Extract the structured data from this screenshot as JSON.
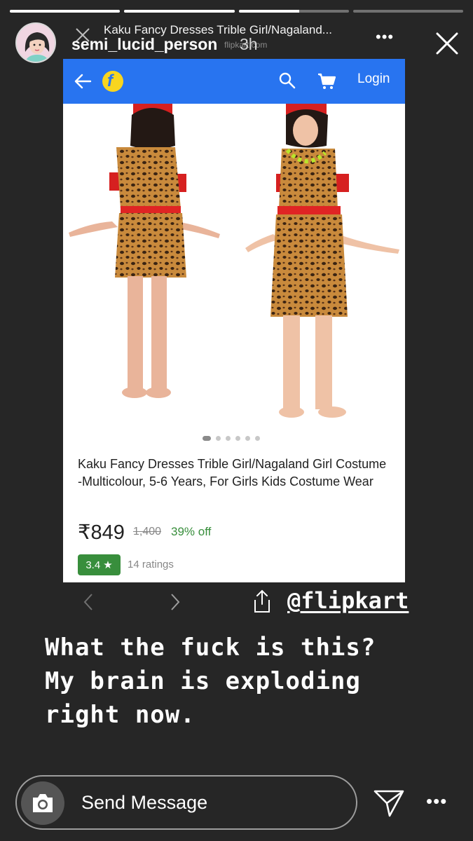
{
  "story": {
    "progress": [
      1,
      1,
      0.55,
      0
    ],
    "username": "semi_lucid_person",
    "time_ago": "3h",
    "close_icon": "close-icon"
  },
  "browser_overlay": {
    "page_title": "Kaku Fancy Dresses Trible Girl/Nagaland...",
    "url_fragment": "flipkart.com"
  },
  "flipkart": {
    "header_color": "#2874f0",
    "login_label": "Login",
    "logo_letter": "f",
    "product": {
      "title": "Kaku Fancy Dresses Trible Girl/Nagaland Girl Costume -Multicolour, 5-6 Years, For Girls Kids Costume Wear",
      "price": "₹849",
      "mrp": "1,400",
      "discount": "39% off",
      "rating": "3.4",
      "rating_star": "★",
      "ratings_count": "14 ratings",
      "image_count": 6,
      "active_image": 1
    },
    "colors": {
      "rating_green": "#388e3c",
      "price_text": "#212121"
    }
  },
  "story_overlay": {
    "mention": "@flipkart",
    "caption": "What the fuck is this?\nMy brain is exploding\nright now."
  },
  "reply": {
    "placeholder": "Send Message"
  }
}
